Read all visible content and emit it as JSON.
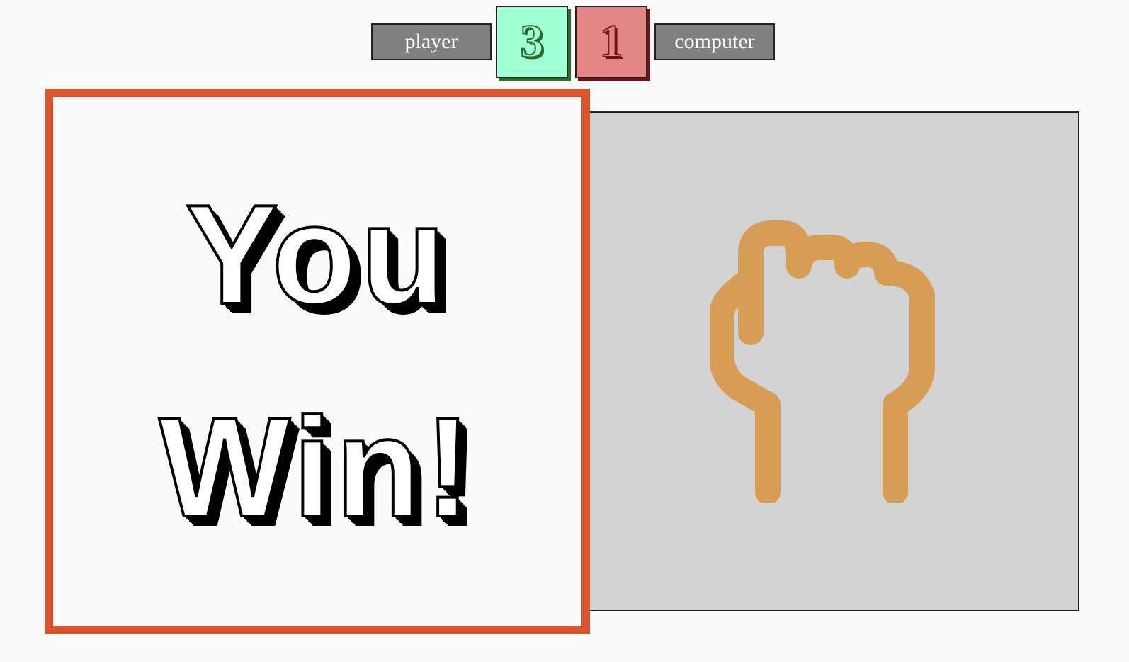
{
  "scoreboard": {
    "player_label": "player",
    "computer_label": "computer",
    "player_score": "3",
    "computer_score": "1",
    "player_score_color": "#a1ffd6",
    "computer_score_color": "#e28786"
  },
  "result": {
    "line1": "You",
    "line2": "Win!",
    "border_color": "#da552f"
  },
  "computer_choice": {
    "icon": "fist-icon",
    "icon_color": "#d79d57",
    "card_color": "#d3d3d3"
  }
}
